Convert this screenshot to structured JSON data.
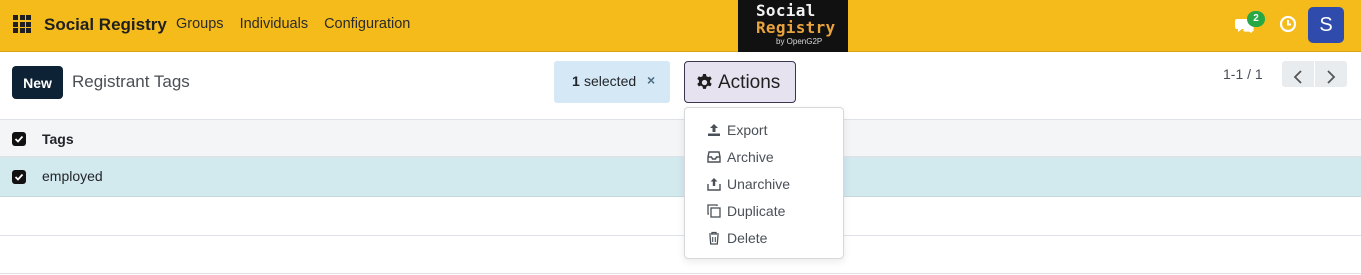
{
  "navbar": {
    "brand": "Social Registry",
    "menu": [
      "Groups",
      "Individuals",
      "Configuration"
    ],
    "logo": {
      "line1": "Social",
      "line2": "Registry",
      "line3": "by OpenG2P"
    },
    "chat_badge": "2",
    "avatar_initial": "S",
    "bg_color": "#f5bb1b",
    "icons": [
      "apps-grid-icon",
      "chat-icon",
      "clock-icon"
    ]
  },
  "control_panel": {
    "new_label": "New",
    "title": "Registrant Tags",
    "selected_count": "1",
    "selected_label": "selected",
    "clear_selection": "×",
    "actions_label": "Actions",
    "pager": "1-1 / 1"
  },
  "list": {
    "columns": [
      "Tags"
    ],
    "rows": [
      {
        "tags": "employed",
        "selected": true
      }
    ]
  },
  "actions_menu": {
    "items": [
      {
        "label": "Export",
        "icon": "upload-icon"
      },
      {
        "label": "Archive",
        "icon": "inbox-icon"
      },
      {
        "label": "Unarchive",
        "icon": "unarchive-icon"
      },
      {
        "label": "Duplicate",
        "icon": "copy-icon"
      },
      {
        "label": "Delete",
        "icon": "trash-icon"
      }
    ]
  }
}
